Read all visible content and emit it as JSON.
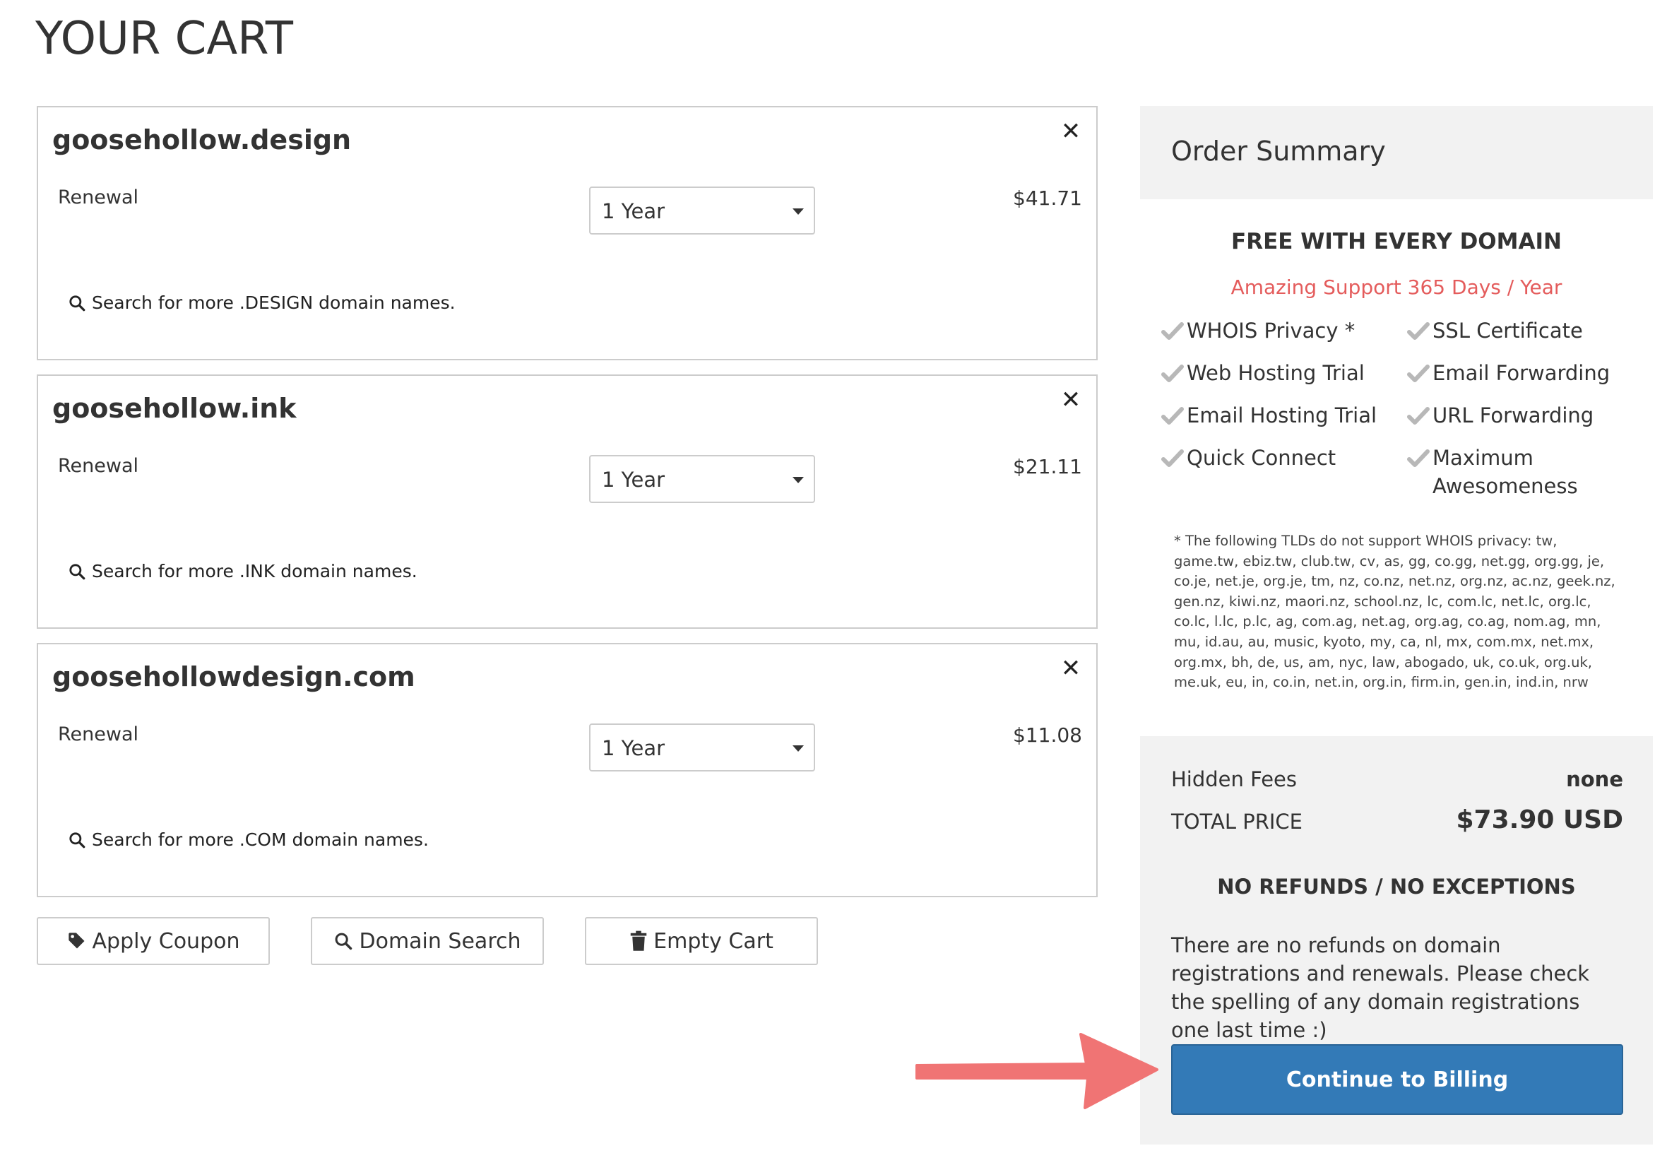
{
  "page": {
    "title": "YOUR CART"
  },
  "cart": {
    "items": [
      {
        "name": "goosehollow.design",
        "type": "Renewal",
        "period": "1 Year",
        "price": "$41.71",
        "search_text": "Search for more .DESIGN domain names."
      },
      {
        "name": "goosehollow.ink",
        "type": "Renewal",
        "period": "1 Year",
        "price": "$21.11",
        "search_text": "Search for more .INK domain names."
      },
      {
        "name": "goosehollowdesign.com",
        "type": "Renewal",
        "period": "1 Year",
        "price": "$11.08",
        "search_text": "Search for more .COM domain names."
      }
    ],
    "remove_glyph": "✕",
    "actions": {
      "apply_coupon": "Apply Coupon",
      "domain_search": "Domain Search",
      "empty_cart": "Empty Cart"
    }
  },
  "summary": {
    "title": "Order Summary",
    "free_title": "FREE WITH EVERY DOMAIN",
    "support_line": "Amazing Support 365 Days / Year",
    "features": [
      "WHOIS Privacy *",
      "SSL Certificate",
      "Web Hosting Trial",
      "Email Forwarding",
      "Email Hosting Trial",
      "URL Forwarding",
      "Quick Connect",
      "Maximum Awesomeness"
    ],
    "footnote": "* The following TLDs do not support WHOIS privacy: tw, game.tw, ebiz.tw, club.tw, cv, as, gg, co.gg, net.gg, org.gg, je, co.je, net.je, org.je, tm, nz, co.nz, net.nz, org.nz, ac.nz, geek.nz, gen.nz, kiwi.nz, maori.nz, school.nz, lc, com.lc, net.lc, org.lc, co.lc, l.lc, p.lc, ag, com.ag, net.ag, org.ag, co.ag, nom.ag, mn, mu, id.au, au, music, kyoto, my, ca, nl, mx, com.mx, net.mx, org.mx, bh, de, us, am, nyc, law, abogado, uk, co.uk, org.uk, me.uk, eu, in, co.in, net.in, org.in, firm.in, gen.in, ind.in, nrw",
    "hidden_fees_label": "Hidden Fees",
    "hidden_fees_value": "none",
    "total_label": "TOTAL PRICE",
    "total_value": "$73.90 USD",
    "no_refunds_title": "NO REFUNDS / NO EXCEPTIONS",
    "refund_text": "There are no refunds on domain registrations and renewals. Please check the spelling of any domain registrations one last time :)",
    "billing_button": "Continue to Billing"
  },
  "colors": {
    "accent_blue": "#337ab7",
    "support_red": "#e45c5c",
    "panel_grey": "#f2f2f2",
    "arrow_red": "#f07474",
    "check_grey": "#b8b8b8"
  },
  "icons": [
    "close-icon",
    "search-icon",
    "tag-icon",
    "trash-icon",
    "checkmark-icon",
    "dropdown-caret-icon",
    "annotation-arrow"
  ]
}
